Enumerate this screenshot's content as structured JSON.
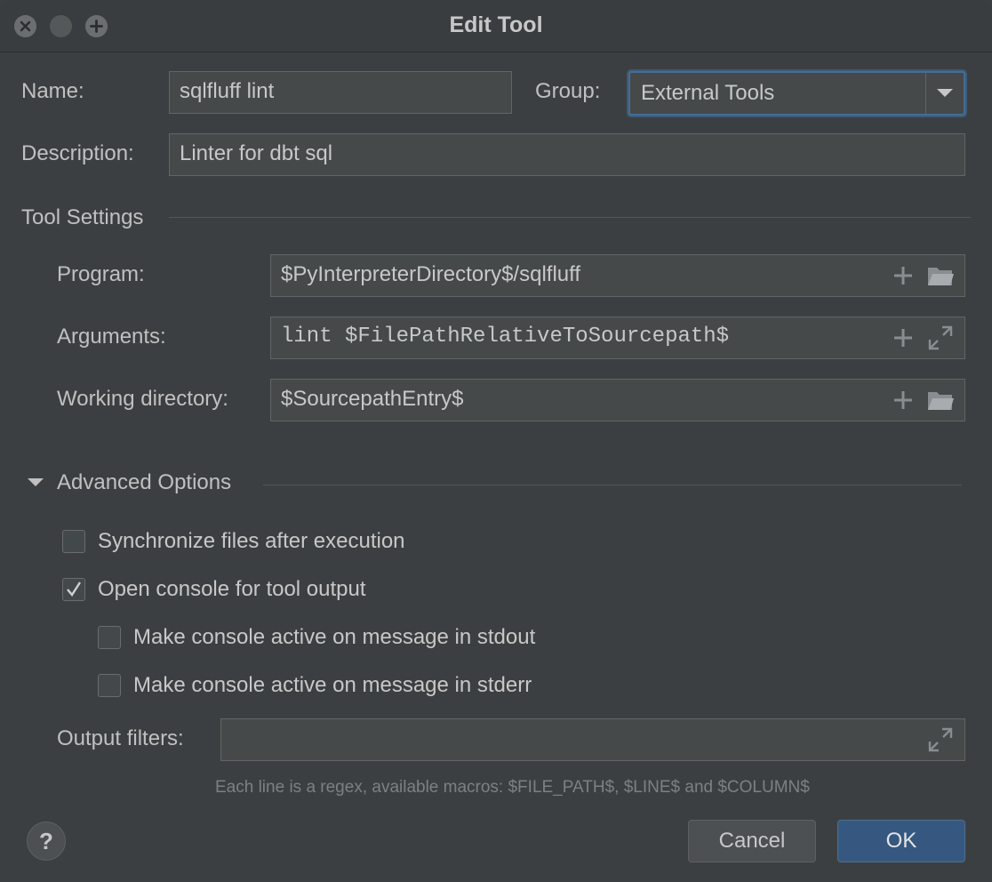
{
  "window": {
    "title": "Edit Tool"
  },
  "form": {
    "name_label": "Name:",
    "name_value": "sqlfluff lint",
    "group_label": "Group:",
    "group_value": "External Tools",
    "description_label": "Description:",
    "description_value": "Linter for dbt sql"
  },
  "tool_settings": {
    "section_title": "Tool Settings",
    "program_label": "Program:",
    "program_value": "$PyInterpreterDirectory$/sqlfluff",
    "arguments_label": "Arguments:",
    "arguments_value": "lint $FilePathRelativeToSourcepath$",
    "workdir_label": "Working directory:",
    "workdir_value": "$SourcepathEntry$"
  },
  "advanced": {
    "section_title": "Advanced Options",
    "expanded": true,
    "checkboxes": [
      {
        "label": "Synchronize files after execution",
        "checked": false
      },
      {
        "label": "Open console for tool output",
        "checked": true
      },
      {
        "label": "Make console active on message in stdout",
        "checked": false
      },
      {
        "label": "Make console active on message in stderr",
        "checked": false
      }
    ],
    "output_filters_label": "Output filters:",
    "output_filters_value": "",
    "hint": "Each line is a regex, available macros: $FILE_PATH$, $LINE$ and $COLUMN$"
  },
  "buttons": {
    "help": "?",
    "cancel": "Cancel",
    "ok": "OK"
  },
  "colors": {
    "background": "#3c3f41",
    "field": "#45494a",
    "accent": "#365880",
    "focus": "#466d94"
  }
}
